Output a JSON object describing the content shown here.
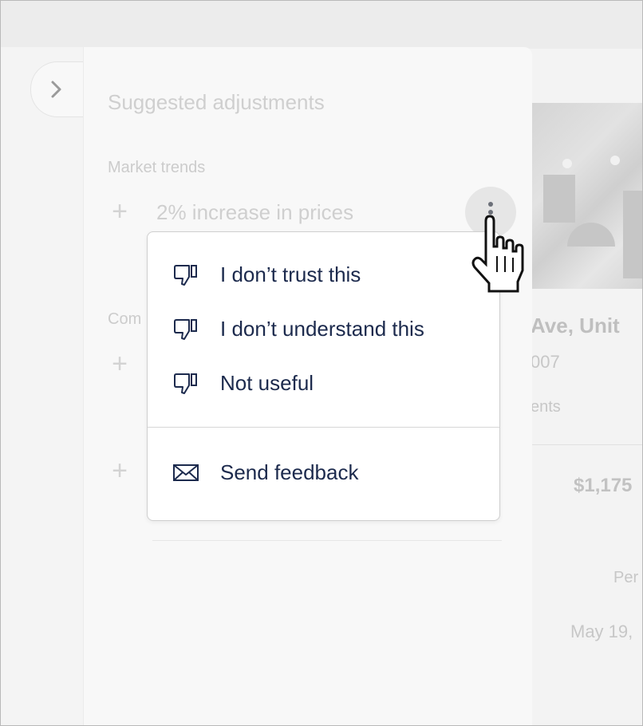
{
  "panel": {
    "title": "Suggested adjustments",
    "sections": [
      {
        "label": "Market trends",
        "items": [
          {
            "text": "2% increase in prices"
          }
        ]
      },
      {
        "label": "Com"
      }
    ]
  },
  "menu": {
    "items": [
      {
        "label": "I don’t trust this",
        "icon": "thumbs-down-icon"
      },
      {
        "label": "I don’t understand this",
        "icon": "thumbs-down-icon"
      },
      {
        "label": "Not useful",
        "icon": "thumbs-down-icon"
      }
    ],
    "feedback": {
      "label": "Send feedback",
      "icon": "envelope-icon"
    }
  },
  "background_listing": {
    "title_fragment": "Ave, Unit",
    "sub_fragment": "007",
    "small_fragment": "ents",
    "price_fragment": "$1,175",
    "per_fragment": "Per",
    "date_fragment": "May 19,"
  },
  "colors": {
    "menu_text": "#1c2a4d",
    "muted_text": "#cfcfcf",
    "more_button_bg": "#e6e6e6"
  }
}
